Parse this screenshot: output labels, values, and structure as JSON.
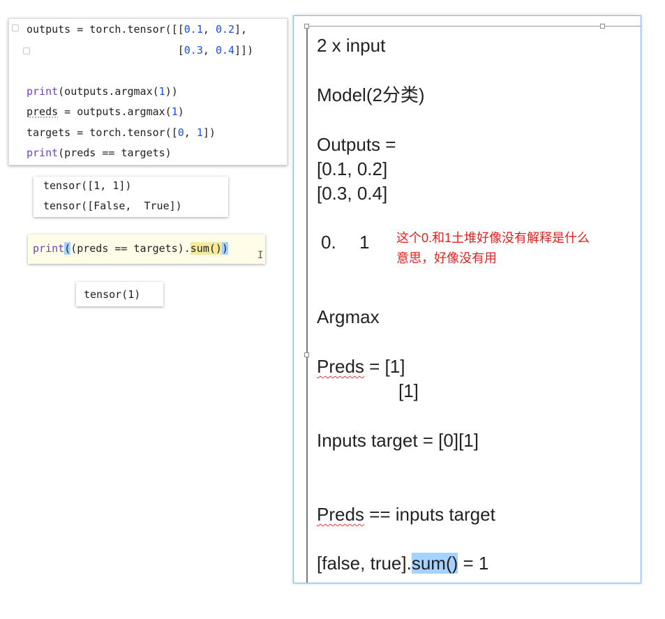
{
  "code_cell": {
    "line1": {
      "prefix": "outputs = torch.tensor([[",
      "n1": "0.1",
      "sep1": ", ",
      "n2": "0.2",
      "suffix": "],"
    },
    "line2": {
      "indent": "                        [",
      "n1": "0.3",
      "sep1": ", ",
      "n2": "0.4",
      "suffix": "]])"
    },
    "line4": {
      "fn": "print",
      "mid": "(outputs.argmax(",
      "n": "1",
      "end": "))"
    },
    "line5": {
      "var": "preds",
      "mid": " = outputs.argmax(",
      "n": "1",
      "end": ")"
    },
    "line6": {
      "prefix": "targets = torch.tensor([",
      "n1": "0",
      "sep": ", ",
      "n2": "1",
      "end": "])"
    },
    "line7": {
      "fn": "print",
      "rest": "(preds == targets)"
    }
  },
  "output1": {
    "line1": "tensor([1, 1])",
    "line2": "tensor([False,  True])"
  },
  "code_cell2": {
    "fn": "print",
    "paren_open": "(",
    "mid": "(preds == targets).",
    "sum": "sum()",
    "paren_close": ")"
  },
  "output2": {
    "line1": "tensor(1)"
  },
  "notes": {
    "l1": "2 x input",
    "l2": "Model(2分类)",
    "l3": "Outputs =",
    "l4": "[0.1, 0.2]",
    "l5": "[0.3, 0.4]",
    "l6a": "0.",
    "l6b": "1",
    "comment1": "这个0.和1土堆好像没有解释是什么",
    "comment2": "意思，好像没有用",
    "l7": "Argmax",
    "l8a": "Preds",
    "l8b": " = [1]",
    "l9": "[1]",
    "l10": "Inputs target = [0][1]",
    "l11a": "Preds",
    "l11b": " == inputs target",
    "l12a": "[false, true].",
    "l12b": "sum()",
    "l12c": " = 1"
  },
  "colors": {
    "keyword": "#6f42c1",
    "number": "#1750eb",
    "annotation": "#e8201c",
    "selection": "#a6d2ff"
  }
}
